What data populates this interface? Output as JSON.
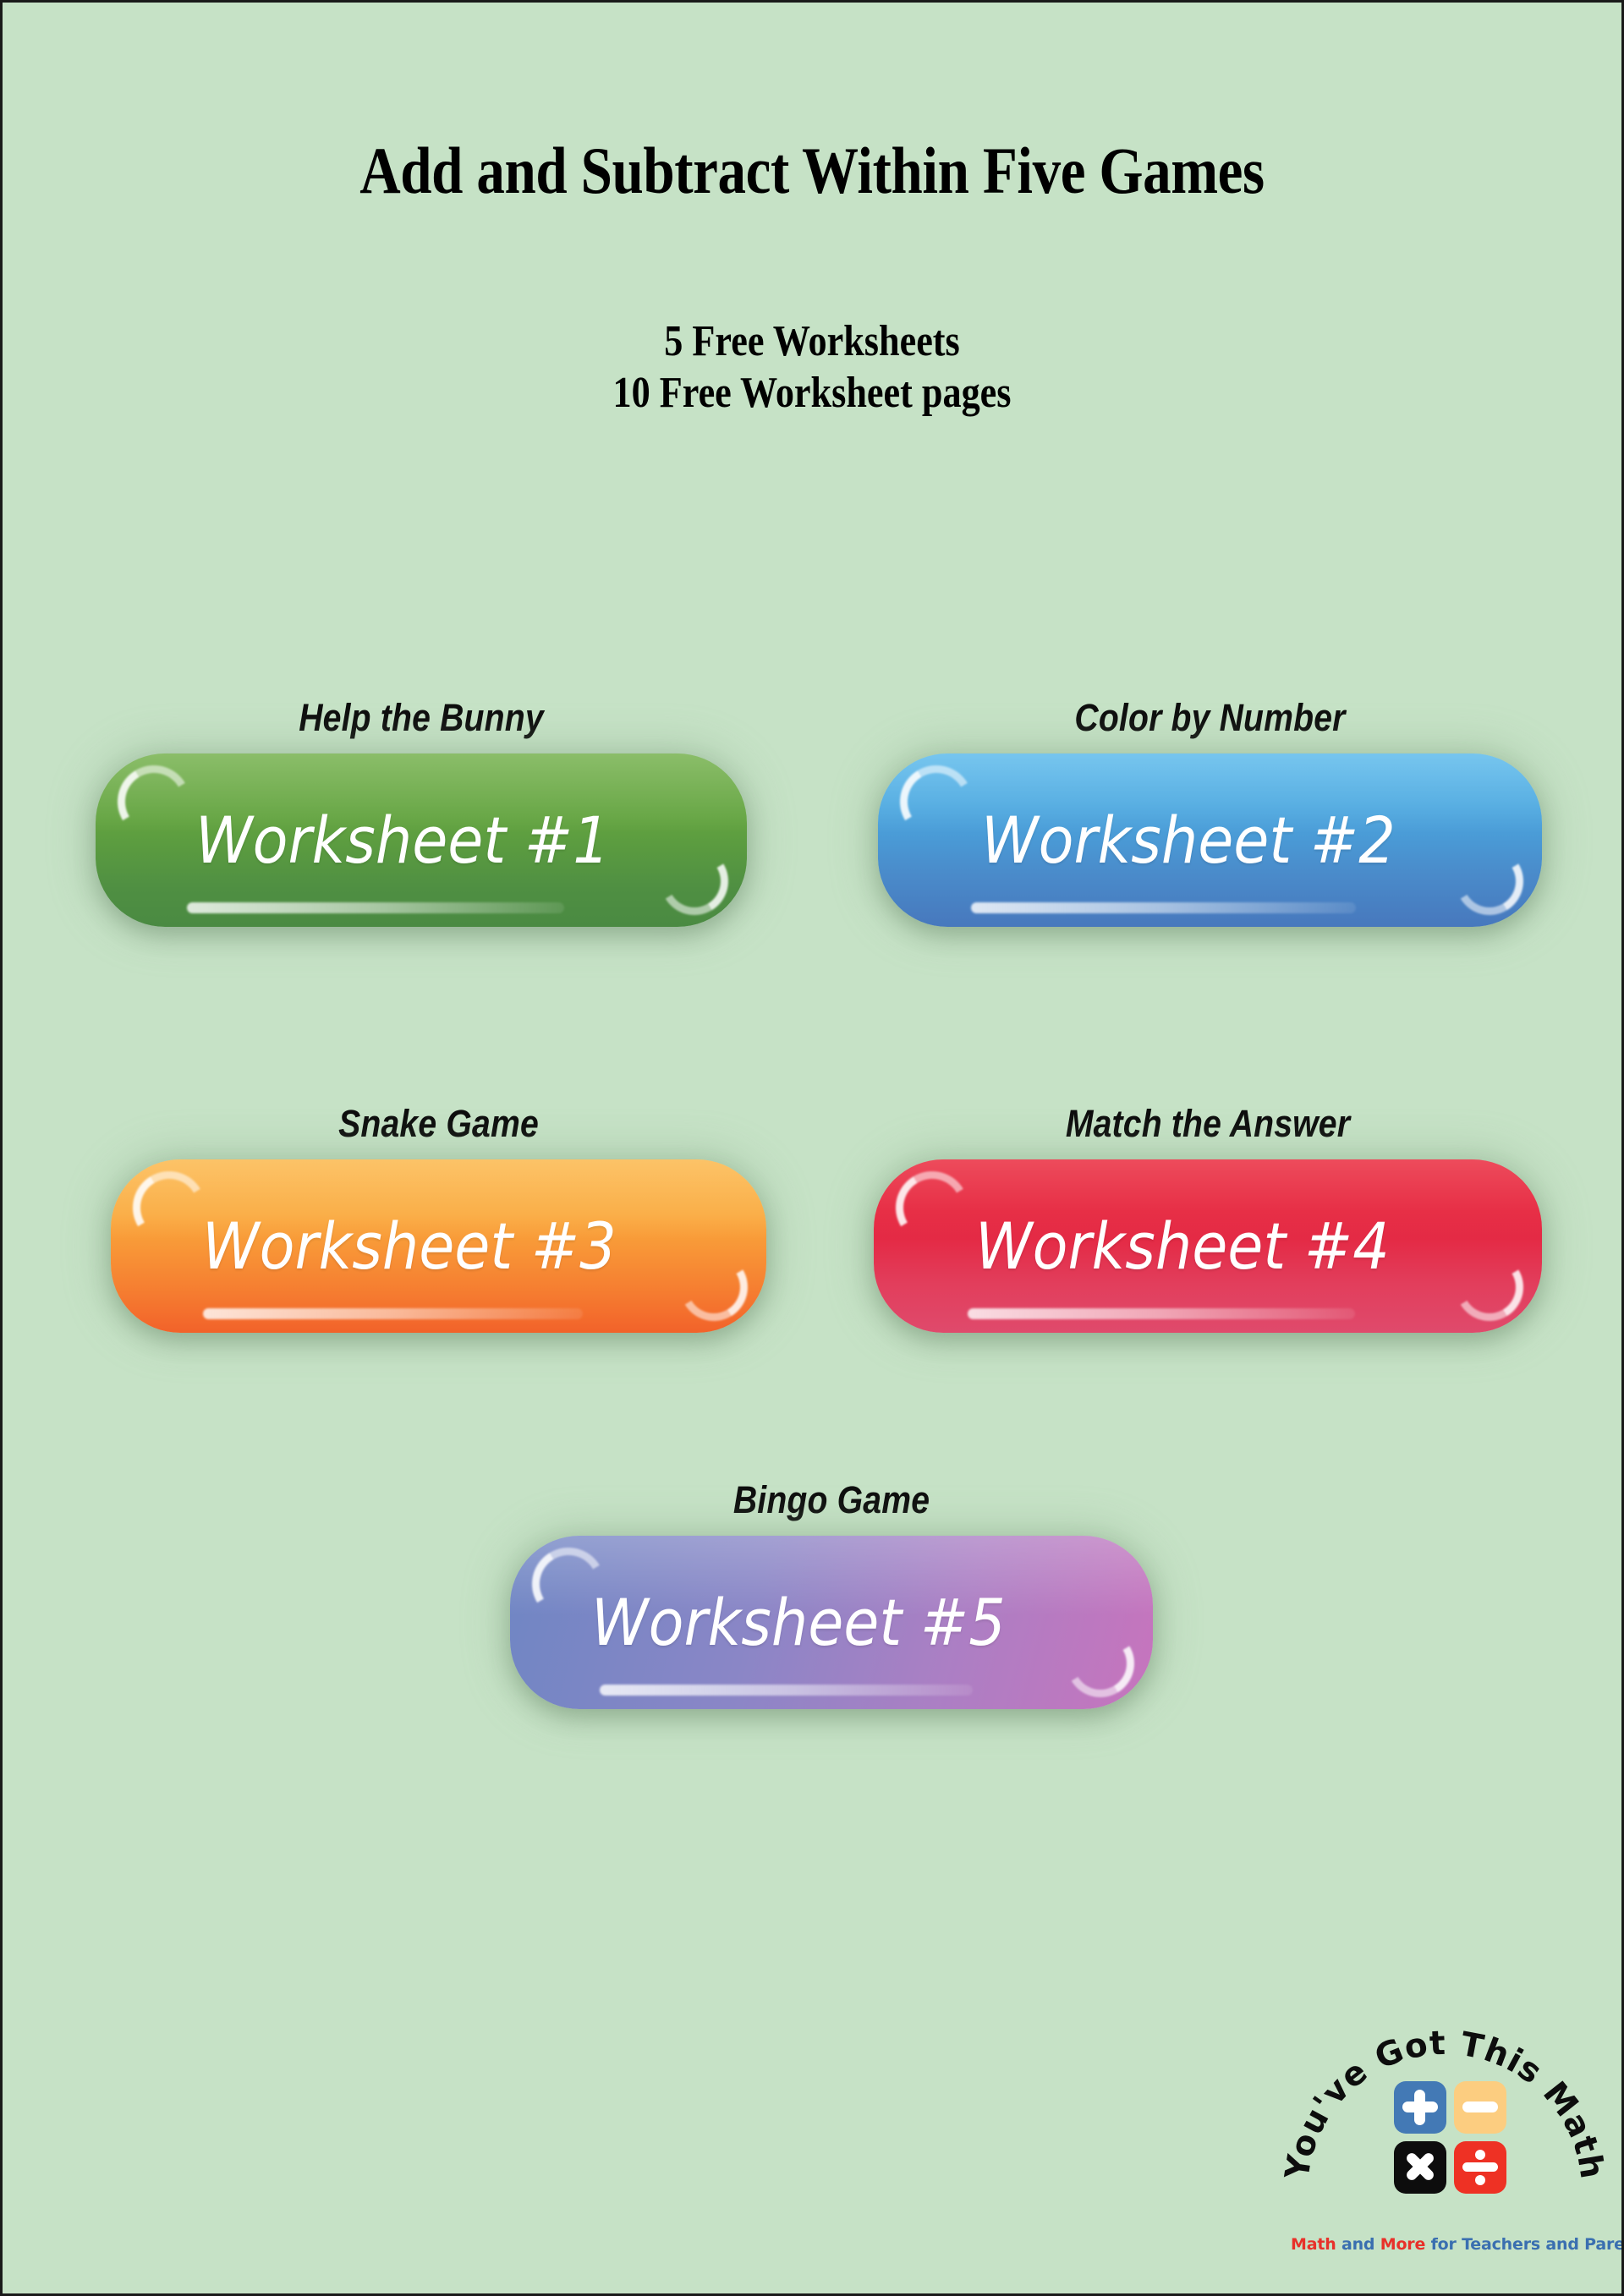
{
  "page": {
    "background_color": "#c6e2c6",
    "border_color": "#1a1a1a"
  },
  "header": {
    "title": "Add and Subtract Within Five Games",
    "subtitle_line1": "5  Free Worksheets",
    "subtitle_line2": "10 Free Worksheet pages"
  },
  "worksheets": [
    {
      "label": "Help the Bunny",
      "button_text": "Worksheet #1",
      "color_top": "#6aab3f",
      "color_bottom": "#4a8a42",
      "gradient_direction": "vertical"
    },
    {
      "label": "Color by Number",
      "button_text": "Worksheet #2",
      "color_top": "#4fb3e8",
      "color_bottom": "#4778bd",
      "gradient_direction": "vertical"
    },
    {
      "label": "Snake Game",
      "button_text": "Worksheet #3",
      "color_top": "#f9b03c",
      "color_bottom": "#f2622a",
      "gradient_direction": "vertical"
    },
    {
      "label": "Match the Answer",
      "button_text": "Worksheet #4",
      "color_top": "#e8192e",
      "color_bottom": "#df4a6c",
      "gradient_direction": "vertical"
    },
    {
      "label": "Bingo Game",
      "button_text": "Worksheet #5",
      "color_top": "#6f86c4",
      "color_bottom": "#c774bd",
      "gradient_direction": "horizontal"
    }
  ],
  "logo": {
    "arc_text": "You've Got This Math",
    "arc_text_color": "#0d0d0d",
    "tiles": [
      {
        "icon": "plus-icon",
        "symbol": "+",
        "color": "#4379b5"
      },
      {
        "icon": "minus-icon",
        "symbol": "−",
        "color": "#fccd80"
      },
      {
        "icon": "times-icon",
        "symbol": "×",
        "color": "#0d0d0d"
      },
      {
        "icon": "divide-icon",
        "symbol": "÷",
        "color": "#ee3124"
      }
    ],
    "tagline_parts": [
      {
        "text": "Math",
        "color": "#e8312a"
      },
      {
        "text": " and ",
        "color": "#3a6fb0"
      },
      {
        "text": "More",
        "color": "#e8312a"
      },
      {
        "text": " for Teachers and Parents",
        "color": "#3a6fb0"
      }
    ]
  }
}
